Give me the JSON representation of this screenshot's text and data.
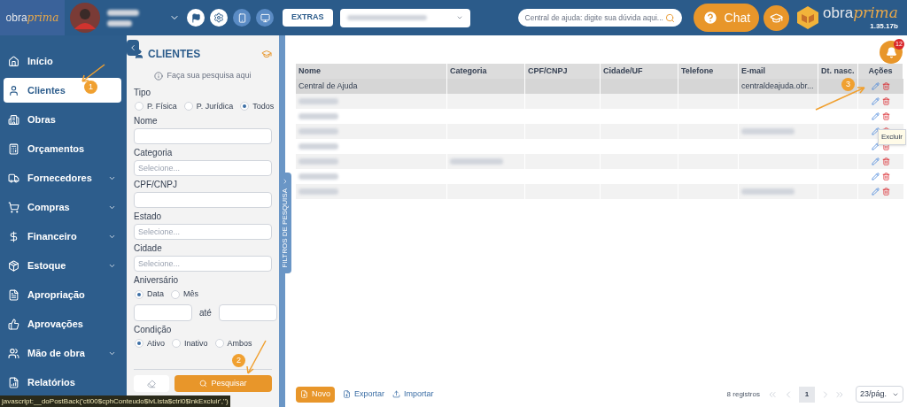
{
  "topbar": {
    "logo": {
      "left": "obra",
      "right": "prima"
    },
    "extras_button": "EXTRAS",
    "help_search": {
      "placeholder": "Central de ajuda: digite sua dúvida aqui..."
    },
    "chat_button": "Chat",
    "brand": {
      "left": "obra",
      "right": "prima"
    },
    "version": "1.35.17b"
  },
  "sidebar": {
    "items": [
      {
        "label": "Início",
        "selected": false,
        "has_submenu": false
      },
      {
        "label": "Clientes",
        "selected": true,
        "has_submenu": false
      },
      {
        "label": "Obras",
        "selected": false,
        "has_submenu": false
      },
      {
        "label": "Orçamentos",
        "selected": false,
        "has_submenu": false
      },
      {
        "label": "Fornecedores",
        "selected": false,
        "has_submenu": true
      },
      {
        "label": "Compras",
        "selected": false,
        "has_submenu": true
      },
      {
        "label": "Financeiro",
        "selected": false,
        "has_submenu": true
      },
      {
        "label": "Estoque",
        "selected": false,
        "has_submenu": true
      },
      {
        "label": "Apropriação",
        "selected": false,
        "has_submenu": false
      },
      {
        "label": "Aprovações",
        "selected": false,
        "has_submenu": false
      },
      {
        "label": "Mão de obra",
        "selected": false,
        "has_submenu": true
      },
      {
        "label": "Relatórios",
        "selected": false,
        "has_submenu": false
      }
    ]
  },
  "filters": {
    "title": "CLIENTES",
    "hint": "Faça sua pesquisa aqui",
    "tab_label": "FILTROS DE PESQUISA",
    "fields": [
      {
        "kind": "radio",
        "label": "Tipo",
        "options": [
          {
            "label": "P. Física",
            "selected": false
          },
          {
            "label": "P. Jurídica",
            "selected": false
          },
          {
            "label": "Todos",
            "selected": true
          }
        ]
      },
      {
        "kind": "text",
        "label": "Nome"
      },
      {
        "kind": "select",
        "label": "Categoria",
        "placeholder": "Selecione..."
      },
      {
        "kind": "text",
        "label": "CPF/CNPJ"
      },
      {
        "kind": "select",
        "label": "Estado",
        "placeholder": "Selecione..."
      },
      {
        "kind": "select",
        "label": "Cidade",
        "placeholder": "Selecione..."
      },
      {
        "kind": "radio",
        "label": "Aniversário",
        "options": [
          {
            "label": "Data",
            "selected": true
          },
          {
            "label": "Mês",
            "selected": false
          }
        ]
      },
      {
        "kind": "range",
        "separator": "até"
      },
      {
        "kind": "radio",
        "label": "Condição",
        "options": [
          {
            "label": "Ativo",
            "selected": true
          },
          {
            "label": "Inativo",
            "selected": false
          },
          {
            "label": "Ambos",
            "selected": false
          }
        ]
      }
    ],
    "search_button": "Pesquisar"
  },
  "notifications": {
    "count": "12"
  },
  "table": {
    "columns": [
      "Nome",
      "Categoria",
      "CPF/CNPJ",
      "Cidade/UF",
      "Telefone",
      "E-mail",
      "Dt. nasc.",
      "Ações"
    ],
    "rows": [
      {
        "selected": true,
        "cells": [
          {
            "kind": "text",
            "text": "Central de Ajuda"
          },
          {
            "kind": "empty"
          },
          {
            "kind": "empty"
          },
          {
            "kind": "empty"
          },
          {
            "kind": "empty"
          },
          {
            "kind": "text",
            "text": "centraldeajuda.obr..."
          },
          {
            "kind": "empty"
          }
        ]
      },
      {
        "selected": false,
        "cells": [
          {
            "kind": "redacted"
          },
          {
            "kind": "empty"
          },
          {
            "kind": "empty"
          },
          {
            "kind": "empty"
          },
          {
            "kind": "empty"
          },
          {
            "kind": "empty"
          },
          {
            "kind": "empty"
          }
        ]
      },
      {
        "selected": false,
        "cells": [
          {
            "kind": "redacted"
          },
          {
            "kind": "empty"
          },
          {
            "kind": "empty"
          },
          {
            "kind": "empty"
          },
          {
            "kind": "empty"
          },
          {
            "kind": "empty"
          },
          {
            "kind": "empty"
          }
        ]
      },
      {
        "selected": false,
        "cells": [
          {
            "kind": "redacted"
          },
          {
            "kind": "empty"
          },
          {
            "kind": "empty"
          },
          {
            "kind": "empty"
          },
          {
            "kind": "empty"
          },
          {
            "kind": "redacted"
          },
          {
            "kind": "empty"
          }
        ]
      },
      {
        "selected": false,
        "cells": [
          {
            "kind": "redacted"
          },
          {
            "kind": "empty"
          },
          {
            "kind": "empty"
          },
          {
            "kind": "empty"
          },
          {
            "kind": "empty"
          },
          {
            "kind": "empty"
          },
          {
            "kind": "empty"
          }
        ]
      },
      {
        "selected": false,
        "cells": [
          {
            "kind": "redacted"
          },
          {
            "kind": "redacted"
          },
          {
            "kind": "empty"
          },
          {
            "kind": "empty"
          },
          {
            "kind": "empty"
          },
          {
            "kind": "empty"
          },
          {
            "kind": "empty"
          }
        ]
      },
      {
        "selected": false,
        "cells": [
          {
            "kind": "redacted"
          },
          {
            "kind": "empty"
          },
          {
            "kind": "empty"
          },
          {
            "kind": "empty"
          },
          {
            "kind": "empty"
          },
          {
            "kind": "empty"
          },
          {
            "kind": "empty"
          }
        ]
      },
      {
        "selected": false,
        "cells": [
          {
            "kind": "redacted"
          },
          {
            "kind": "empty"
          },
          {
            "kind": "empty"
          },
          {
            "kind": "empty"
          },
          {
            "kind": "empty"
          },
          {
            "kind": "redacted"
          },
          {
            "kind": "empty"
          }
        ]
      }
    ],
    "tooltip": "Excluir"
  },
  "footer": {
    "new_button": "Novo",
    "export_link": "Exportar",
    "import_link": "Importar",
    "records": "8 registros",
    "page": "1",
    "per_page": "23/pág."
  },
  "annotations": [
    "1",
    "2",
    "3"
  ],
  "status_bar": "javascript:__doPostBack('ctl00$cphConteudo$lvLista$ctrl0$lnkExcluir','')"
}
